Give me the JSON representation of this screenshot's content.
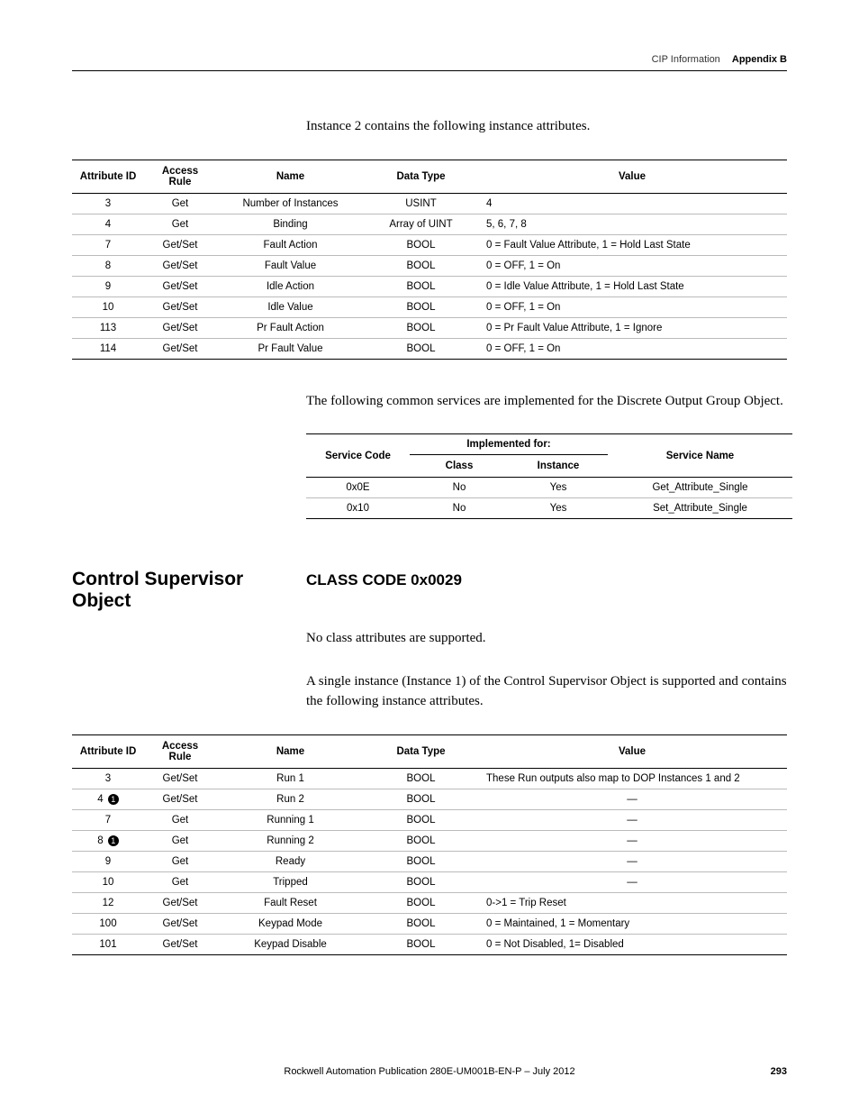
{
  "header": {
    "label": "CIP Information",
    "appendix": "Appendix B"
  },
  "intro1": "Instance 2 contains the following instance attributes.",
  "table1": {
    "headers": [
      "Attribute ID",
      "Access Rule",
      "Name",
      "Data Type",
      "Value"
    ],
    "rows": [
      [
        "3",
        "Get",
        "Number of Instances",
        "USINT",
        "4"
      ],
      [
        "4",
        "Get",
        "Binding",
        "Array of UINT",
        "5, 6, 7, 8"
      ],
      [
        "7",
        "Get/Set",
        "Fault Action",
        "BOOL",
        "0 = Fault Value Attribute, 1 = Hold Last State"
      ],
      [
        "8",
        "Get/Set",
        "Fault Value",
        "BOOL",
        "0 = OFF, 1 = On"
      ],
      [
        "9",
        "Get/Set",
        "Idle Action",
        "BOOL",
        "0 = Idle Value Attribute, 1 = Hold Last State"
      ],
      [
        "10",
        "Get/Set",
        "Idle Value",
        "BOOL",
        "0 = OFF, 1 = On"
      ],
      [
        "113",
        "Get/Set",
        "Pr Fault Action",
        "BOOL",
        "0 = Pr Fault Value Attribute, 1 = Ignore"
      ],
      [
        "114",
        "Get/Set",
        "Pr Fault Value",
        "BOOL",
        "0 = OFF, 1 = On"
      ]
    ]
  },
  "intro2": "The following common services are implemented for the Discrete Output Group Object.",
  "table2": {
    "group_header": "Implemented for:",
    "headers": [
      "Service Code",
      "Class",
      "Instance",
      "Service Name"
    ],
    "rows": [
      [
        "0x0E",
        "No",
        "Yes",
        "Get_Attribute_Single"
      ],
      [
        "0x10",
        "No",
        "Yes",
        "Set_Attribute_Single"
      ]
    ]
  },
  "section": {
    "title": "Control Supervisor Object",
    "subtitle": "CLASS CODE 0x0029"
  },
  "intro3": "No class attributes are supported.",
  "intro4": "A single instance (Instance 1) of the Control Supervisor Object is supported and contains the following instance attributes.",
  "table3": {
    "headers": [
      "Attribute ID",
      "Access Rule",
      "Name",
      "Data Type",
      "Value"
    ],
    "rows": [
      {
        "id": "3",
        "note": false,
        "access": "Get/Set",
        "name": "Run 1",
        "type": "BOOL",
        "value": "These Run outputs also map to DOP Instances 1 and 2"
      },
      {
        "id": "4",
        "note": true,
        "access": "Get/Set",
        "name": "Run 2",
        "type": "BOOL",
        "value": "—"
      },
      {
        "id": "7",
        "note": false,
        "access": "Get",
        "name": "Running 1",
        "type": "BOOL",
        "value": "—"
      },
      {
        "id": "8",
        "note": true,
        "access": "Get",
        "name": "Running 2",
        "type": "BOOL",
        "value": "—"
      },
      {
        "id": "9",
        "note": false,
        "access": "Get",
        "name": "Ready",
        "type": "BOOL",
        "value": "—"
      },
      {
        "id": "10",
        "note": false,
        "access": "Get",
        "name": "Tripped",
        "type": "BOOL",
        "value": "—"
      },
      {
        "id": "12",
        "note": false,
        "access": "Get/Set",
        "name": "Fault Reset",
        "type": "BOOL",
        "value": "0->1 = Trip Reset"
      },
      {
        "id": "100",
        "note": false,
        "access": "Get/Set",
        "name": "Keypad Mode",
        "type": "BOOL",
        "value": "0 = Maintained, 1 = Momentary"
      },
      {
        "id": "101",
        "note": false,
        "access": "Get/Set",
        "name": "Keypad Disable",
        "type": "BOOL",
        "value": "0 = Not Disabled, 1= Disabled"
      }
    ]
  },
  "footer": {
    "pub": "Rockwell Automation Publication 280E-UM001B-EN-P – July 2012",
    "page": "293"
  }
}
